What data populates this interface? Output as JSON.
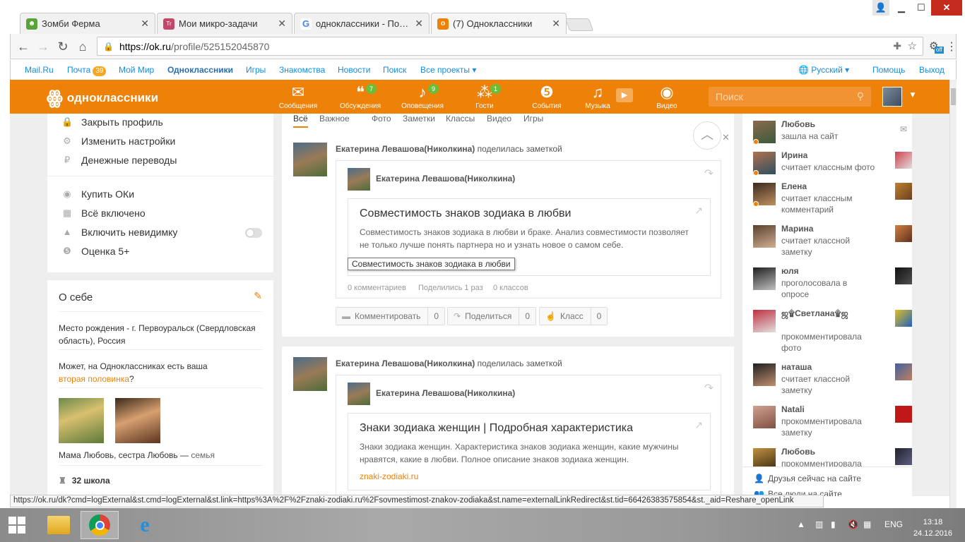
{
  "browser": {
    "tabs": [
      {
        "title": "Зомби Ферма",
        "icon_color": "#5aa33a",
        "icon": "☻"
      },
      {
        "title": "Мои микро-задачи",
        "icon_color": "#c2486a",
        "icon": "Tr"
      },
      {
        "title": "одноклассники - Поиск",
        "icon_color": "#ffffff",
        "icon": "G"
      },
      {
        "title": "(7) Одноклассники",
        "icon_color": "#ee8208",
        "icon": "о"
      }
    ],
    "url_host": "https://ok.ru",
    "url_path": "/profile/525152045870",
    "status_url": "https://ok.ru/dk?cmd=logExternal&st.cmd=logExternal&st.link=https%3A%2F%2Fznaki-zodiaki.ru%2Fsovmestimost-znakov-zodiaka&st.name=externalLinkRedirect&st.tid=66426383575854&st._aid=Reshare_openLink",
    "ext_badge": "off"
  },
  "portal": {
    "links": [
      "Mail.Ru",
      "Почта",
      "Мой Мир",
      "Одноклассники",
      "Игры",
      "Знакомства",
      "Новости",
      "Поиск",
      "Все проекты"
    ],
    "mail_count": "39",
    "language": "Русский",
    "help": "Помощь",
    "logout": "Выход"
  },
  "ok_header": {
    "logo_text": "одноклассники",
    "nav": [
      {
        "label": "Сообщения",
        "icon": "✉",
        "count": ""
      },
      {
        "label": "Обсуждения",
        "icon": "💬",
        "count": "7"
      },
      {
        "label": "Оповещения",
        "icon": "🔔",
        "count": "9"
      },
      {
        "label": "Гости",
        "icon": "👣",
        "count": "1"
      },
      {
        "label": "События",
        "icon": "5",
        "count": ""
      },
      {
        "label": "Музыка",
        "icon": "♫",
        "count": ""
      },
      {
        "label": "Видео",
        "icon": "🎥",
        "count": ""
      }
    ],
    "search_placeholder": "Поиск"
  },
  "left_menu": {
    "group1": [
      "Закрыть профиль",
      "Изменить настройки",
      "Денежные переводы"
    ],
    "group2": [
      "Купить ОКи",
      "Всё включено",
      "Включить невидимку",
      "Оценка 5+"
    ]
  },
  "about": {
    "title": "О себе",
    "birthplace": "Место рождения - г. Первоуральск (Свердловская область), Россия",
    "half_prefix": "Может, на Одноклассниках есть ваша",
    "half_link": "вторая половинка",
    "half_suffix": "?",
    "family_names": "Мама Любовь, сестра Любовь",
    "family_sep": " — ",
    "family_label": "семья",
    "school": "32 школа"
  },
  "feed_tabs": [
    "Всё",
    "Важное",
    "Фото",
    "Заметки",
    "Классы",
    "Видео",
    "Игры"
  ],
  "posts": [
    {
      "author": "Екатерина Левашова(Николкина)",
      "action": "поделилась заметкой",
      "inner_author": "Екатерина Левашова(Николкина)",
      "link_title": "Совместимость знаков зодиака в любви",
      "link_desc": "Совместимость знаков зодиака в любви и браке. Анализ совместимости позволяет не только лучше понять партнера но и узнать новое о самом себе.",
      "tooltip": "Совместимость знаков зодиака в любви",
      "stats": [
        "0 комментариев",
        "Поделились 1 раз",
        "0 классов"
      ],
      "buttons": [
        {
          "label": "Комментировать",
          "count": "0"
        },
        {
          "label": "Поделиться",
          "count": "0"
        },
        {
          "label": "Класс",
          "count": "0"
        }
      ]
    },
    {
      "author": "Екатерина Левашова(Николкина)",
      "action": "поделилась заметкой",
      "inner_author": "Екатерина Левашова(Николкина)",
      "link_title": "Знаки зодиака женщин | Подробная характеристика",
      "link_desc": "Знаки зодиака женщин. Характеристика знаков зодиака женщин, какие мужчины нравятся, какие в любви. Полное описание знаков зодиака женщин.",
      "link_domain": "znaki-zodiaki.ru"
    }
  ],
  "activity": [
    {
      "name": "Любовь",
      "text": "зашла на сайт"
    },
    {
      "name": "Ирина",
      "text": "считает классным фото"
    },
    {
      "name": "Елена",
      "text": "считает классным комментарий"
    },
    {
      "name": "Марина",
      "text": "считает классной заметку"
    },
    {
      "name": "юля",
      "text": "проголосовала в опросе"
    },
    {
      "name": "ஜ۩Светлана۩ஜ",
      "text": "прокомментировала фото"
    },
    {
      "name": "наташа",
      "text": "считает классной заметку"
    },
    {
      "name": "Natali",
      "text": "прокомментировала заметку"
    },
    {
      "name": "Любовь",
      "text": "прокомментировала"
    }
  ],
  "friends_online": "Друзья сейчас на сайте",
  "all_people": "Все люди на сайте",
  "taskbar": {
    "lang": "ENG",
    "time": "13:18",
    "date": "24.12.2016"
  },
  "colors": {
    "ok_orange": "#ee8208",
    "link_blue": "#168de2",
    "badge_green": "#6cbd3a"
  }
}
